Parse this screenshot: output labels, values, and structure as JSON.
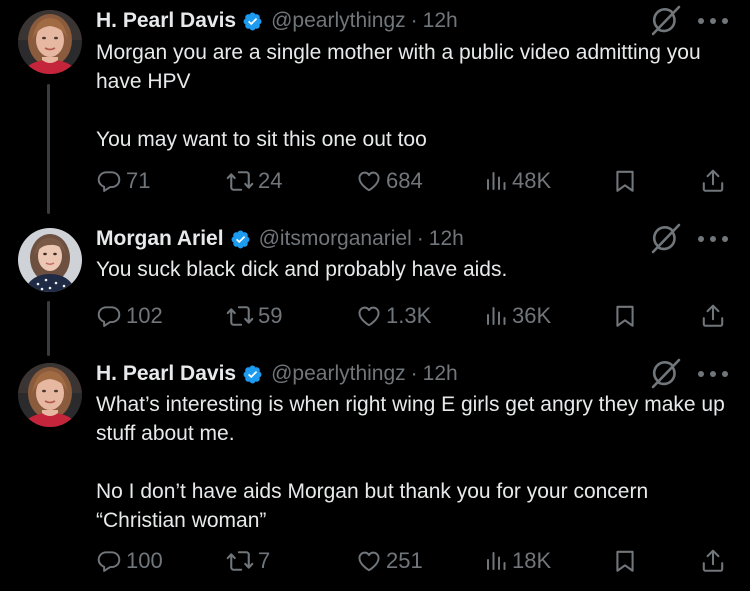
{
  "colors": {
    "background": "#000000",
    "text": "#e7e9ea",
    "muted": "#71767b",
    "verified": "#1d9bf0",
    "thread_line": "#3a3d40"
  },
  "tweets": [
    {
      "name": "H. Pearl Davis",
      "handle": "@pearlythingz",
      "separator": "·",
      "time": "12h",
      "verified": true,
      "avatar": "avatar-pearl",
      "text": "Morgan you are a single mother with a public video admitting you have HPV\n\nYou may want to sit this one out too",
      "replies": "71",
      "reposts": "24",
      "likes": "684",
      "views": "48K"
    },
    {
      "name": "Morgan Ariel",
      "handle": "@itsmorganariel",
      "separator": "·",
      "time": "12h",
      "verified": true,
      "avatar": "avatar-morgan",
      "text": "You suck black dick and probably have aids.",
      "replies": "102",
      "reposts": "59",
      "likes": "1.3K",
      "views": "36K"
    },
    {
      "name": "H. Pearl Davis",
      "handle": "@pearlythingz",
      "separator": "·",
      "time": "12h",
      "verified": true,
      "avatar": "avatar-pearl",
      "text": "What’s interesting is when right wing E girls get angry they make up stuff about me.\n\nNo I don’t have aids Morgan but thank you for your concern “Christian woman”",
      "replies": "100",
      "reposts": "7",
      "likes": "251",
      "views": "18K"
    }
  ],
  "icons": {
    "reply": "reply-icon",
    "repost": "repost-icon",
    "like": "heart-icon",
    "views": "views-icon",
    "bookmark": "bookmark-icon",
    "share": "share-icon",
    "grok": "grok-icon",
    "more": "more-icon",
    "verified": "verified-badge-icon"
  }
}
